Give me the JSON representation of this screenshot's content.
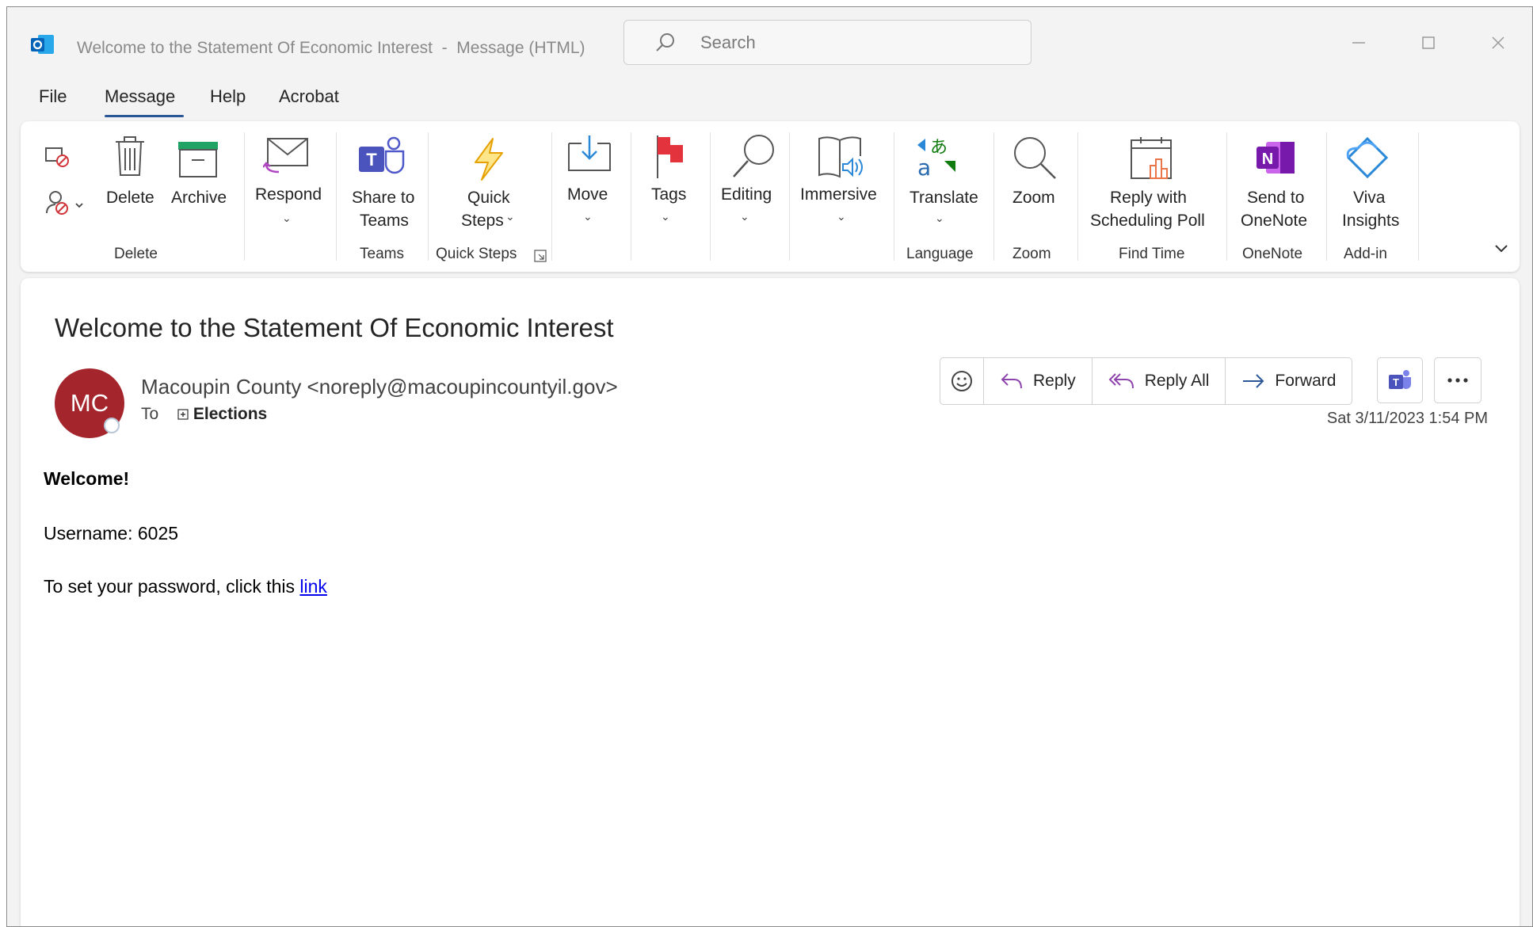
{
  "window": {
    "title": "Welcome to the Statement Of Economic Interest  -  Message (HTML)",
    "search_placeholder": "Search",
    "icons": [
      "outlook-app-icon",
      "search-icon",
      "minimize-icon",
      "maximize-icon",
      "close-icon"
    ]
  },
  "menu": {
    "items": [
      "File",
      "Message",
      "Help",
      "Acrobat"
    ],
    "active": "Message"
  },
  "ribbon": {
    "buttons": {
      "delete": "Delete",
      "archive": "Archive",
      "respond": "Respond",
      "share_teams_1": "Share to",
      "share_teams_2": "Teams",
      "quick_steps_1": "Quick",
      "quick_steps_2": "Steps",
      "move": "Move",
      "tags": "Tags",
      "editing": "Editing",
      "immersive": "Immersive",
      "translate": "Translate",
      "zoom": "Zoom",
      "reply_poll_1": "Reply with",
      "reply_poll_2": "Scheduling Poll",
      "send_onenote_1": "Send to",
      "send_onenote_2": "OneNote",
      "viva_1": "Viva",
      "viva_2": "Insights"
    },
    "groups": {
      "delete": "Delete",
      "teams": "Teams",
      "quick_steps": "Quick Steps",
      "language": "Language",
      "zoom": "Zoom",
      "find_time": "Find Time",
      "onenote": "OneNote",
      "addin": "Add-in"
    }
  },
  "message": {
    "subject": "Welcome to the Statement Of Economic Interest",
    "avatar_initials": "MC",
    "avatar_color": "#a4262c",
    "from": "Macoupin County <noreply@macoupincountyil.gov>",
    "to_label": "To",
    "to_recipient": "Elections",
    "date": "Sat 3/11/2023 1:54 PM",
    "actions": {
      "reply": "Reply",
      "reply_all": "Reply All",
      "forward": "Forward"
    },
    "body": {
      "greeting": "Welcome!",
      "username_line": "Username: 6025",
      "password_line": "To set your password, click this ",
      "link_text": "link"
    }
  },
  "colors": {
    "accent": "#2b5797",
    "link": "#0000ee",
    "teams": "#5059c9",
    "onenote": "#7719aa",
    "flag": "#e3333c"
  }
}
